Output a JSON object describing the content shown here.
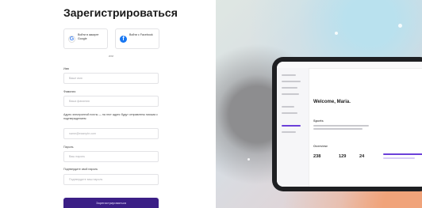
{
  "form": {
    "title": "Зарегистрироваться",
    "google_button": "Войти в аккаунт Google",
    "facebook_button": "Войти с Facebook",
    "divider": "или",
    "fields": [
      {
        "label": "Имя",
        "placeholder": "Ваше имя"
      },
      {
        "label": "Фамилия",
        "placeholder": "Ваша фамилия"
      },
      {
        "label": "Адрес электронной почты — на этот адрес будут отправлены письма с подтверждением",
        "placeholder": "name@example.com"
      },
      {
        "label": "Пароль",
        "placeholder": "Ваш пароль"
      },
      {
        "label": "Подтвердите свой пароль",
        "placeholder": "Подтвердите ваш пароль"
      }
    ],
    "submit": "Зарегистрироваться"
  },
  "preview": {
    "greeting": "Welcome, Maria.",
    "card_title": "Sports",
    "stat_title": "Overview",
    "stats": [
      "238",
      "129",
      "24"
    ]
  },
  "colors": {
    "accent": "#3b1f86",
    "preview_accent": "#6b3fd9"
  }
}
